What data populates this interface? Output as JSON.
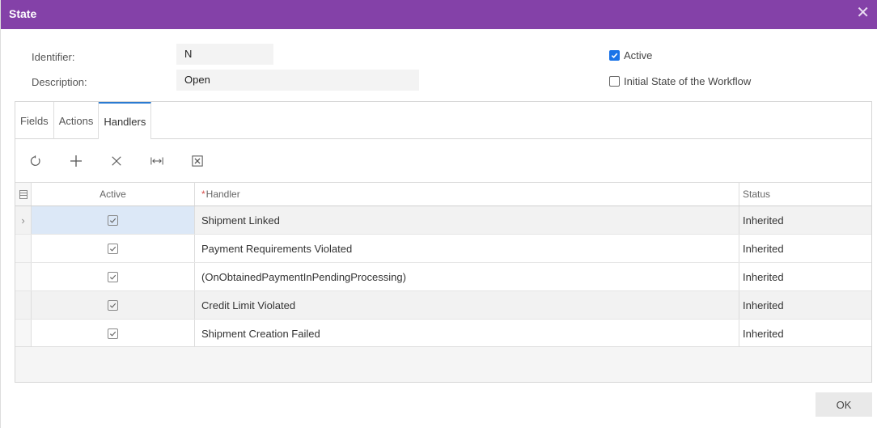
{
  "dialog": {
    "title": "State"
  },
  "form": {
    "identifier_label": "Identifier:",
    "identifier_value": "N",
    "description_label": "Description:",
    "description_value": "Open",
    "active_label": "Active",
    "active_checked": true,
    "initial_label": "Initial State of the Workflow",
    "initial_checked": false
  },
  "tabs": [
    {
      "label": "Fields"
    },
    {
      "label": "Actions"
    },
    {
      "label": "Handlers",
      "active": true
    }
  ],
  "toolbar": {
    "buttons": [
      {
        "icon": "refresh-icon"
      },
      {
        "icon": "add-icon"
      },
      {
        "icon": "delete-icon"
      },
      {
        "icon": "fit-width-icon"
      },
      {
        "icon": "excel-export-icon"
      }
    ]
  },
  "grid": {
    "columns": {
      "active": "Active",
      "handler": "Handler",
      "status": "Status"
    },
    "rows": [
      {
        "active": true,
        "handler": "Shipment Linked",
        "status": "Inherited"
      },
      {
        "active": true,
        "handler": "Payment Requirements Violated",
        "status": "Inherited"
      },
      {
        "active": true,
        "handler": "(OnObtainedPaymentInPendingProcessing)",
        "status": "Inherited"
      },
      {
        "active": true,
        "handler": "Credit Limit Violated",
        "status": "Inherited"
      },
      {
        "active": true,
        "handler": "Shipment Creation Failed",
        "status": "Inherited"
      }
    ]
  },
  "footer": {
    "ok_label": "OK"
  },
  "colors": {
    "titlebar": "#8441a8",
    "accent": "#1a73e8",
    "tab_active": "#2b7bd1"
  }
}
